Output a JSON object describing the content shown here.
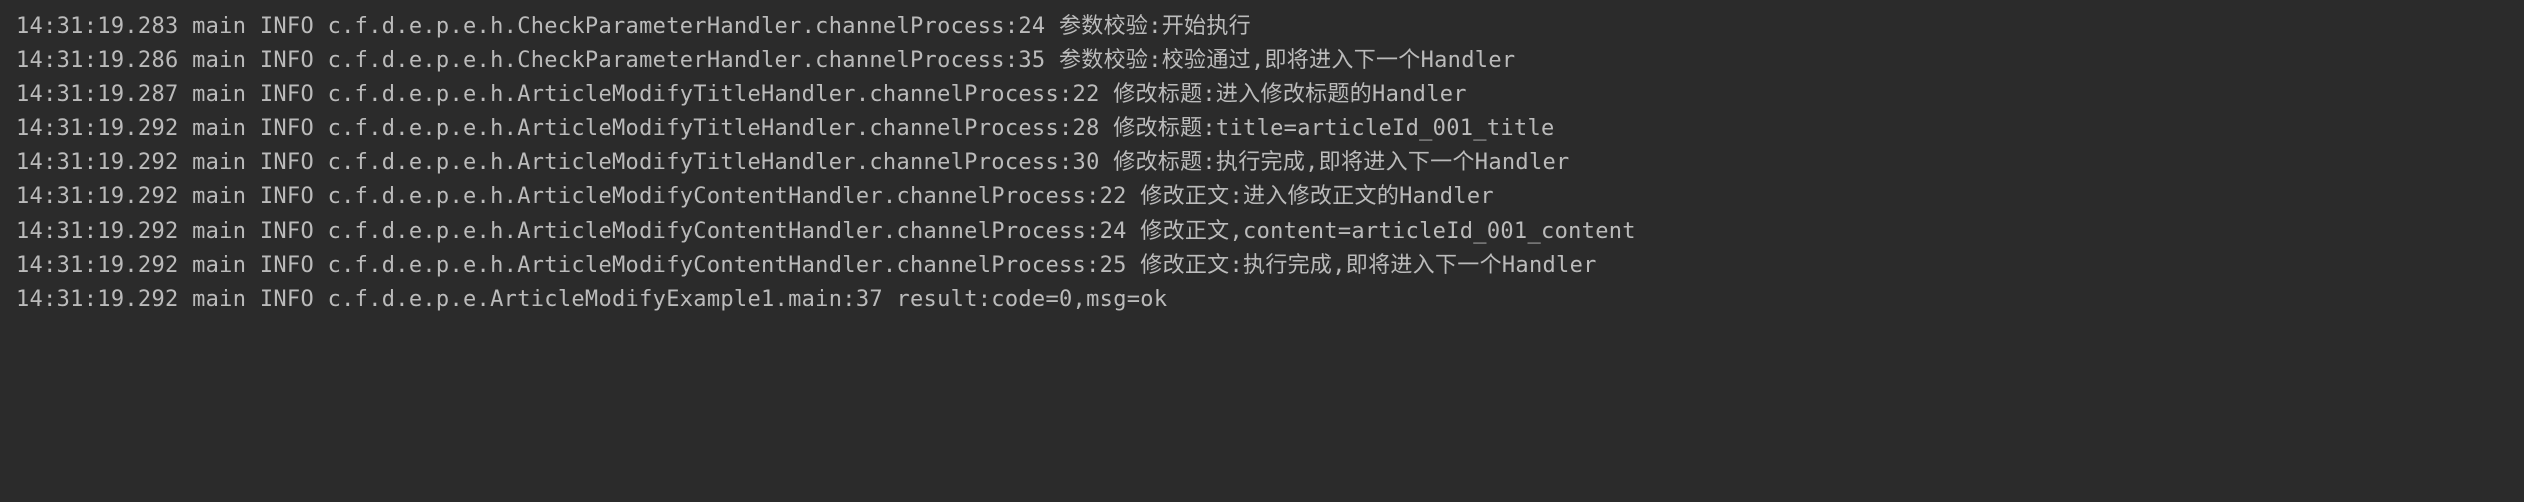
{
  "log_lines": [
    {
      "timestamp": "14:31:19.283",
      "thread": "main",
      "level": "INFO",
      "logger": "c.f.d.e.p.e.h.CheckParameterHandler.channelProcess:24",
      "message": "参数校验:开始执行"
    },
    {
      "timestamp": "14:31:19.286",
      "thread": "main",
      "level": "INFO",
      "logger": "c.f.d.e.p.e.h.CheckParameterHandler.channelProcess:35",
      "message": "参数校验:校验通过,即将进入下一个Handler"
    },
    {
      "timestamp": "14:31:19.287",
      "thread": "main",
      "level": "INFO",
      "logger": "c.f.d.e.p.e.h.ArticleModifyTitleHandler.channelProcess:22",
      "message": "修改标题:进入修改标题的Handler"
    },
    {
      "timestamp": "14:31:19.292",
      "thread": "main",
      "level": "INFO",
      "logger": "c.f.d.e.p.e.h.ArticleModifyTitleHandler.channelProcess:28",
      "message": "修改标题:title=articleId_001_title"
    },
    {
      "timestamp": "14:31:19.292",
      "thread": "main",
      "level": "INFO",
      "logger": "c.f.d.e.p.e.h.ArticleModifyTitleHandler.channelProcess:30",
      "message": "修改标题:执行完成,即将进入下一个Handler"
    },
    {
      "timestamp": "14:31:19.292",
      "thread": "main",
      "level": "INFO",
      "logger": "c.f.d.e.p.e.h.ArticleModifyContentHandler.channelProcess:22",
      "message": "修改正文:进入修改正文的Handler"
    },
    {
      "timestamp": "14:31:19.292",
      "thread": "main",
      "level": "INFO",
      "logger": "c.f.d.e.p.e.h.ArticleModifyContentHandler.channelProcess:24",
      "message": "修改正文,content=articleId_001_content"
    },
    {
      "timestamp": "14:31:19.292",
      "thread": "main",
      "level": "INFO",
      "logger": "c.f.d.e.p.e.h.ArticleModifyContentHandler.channelProcess:25",
      "message": "修改正文:执行完成,即将进入下一个Handler"
    },
    {
      "timestamp": "14:31:19.292",
      "thread": "main",
      "level": "INFO",
      "logger": "c.f.d.e.p.e.ArticleModifyExample1.main:37",
      "message": "result:code=0,msg=ok"
    }
  ]
}
